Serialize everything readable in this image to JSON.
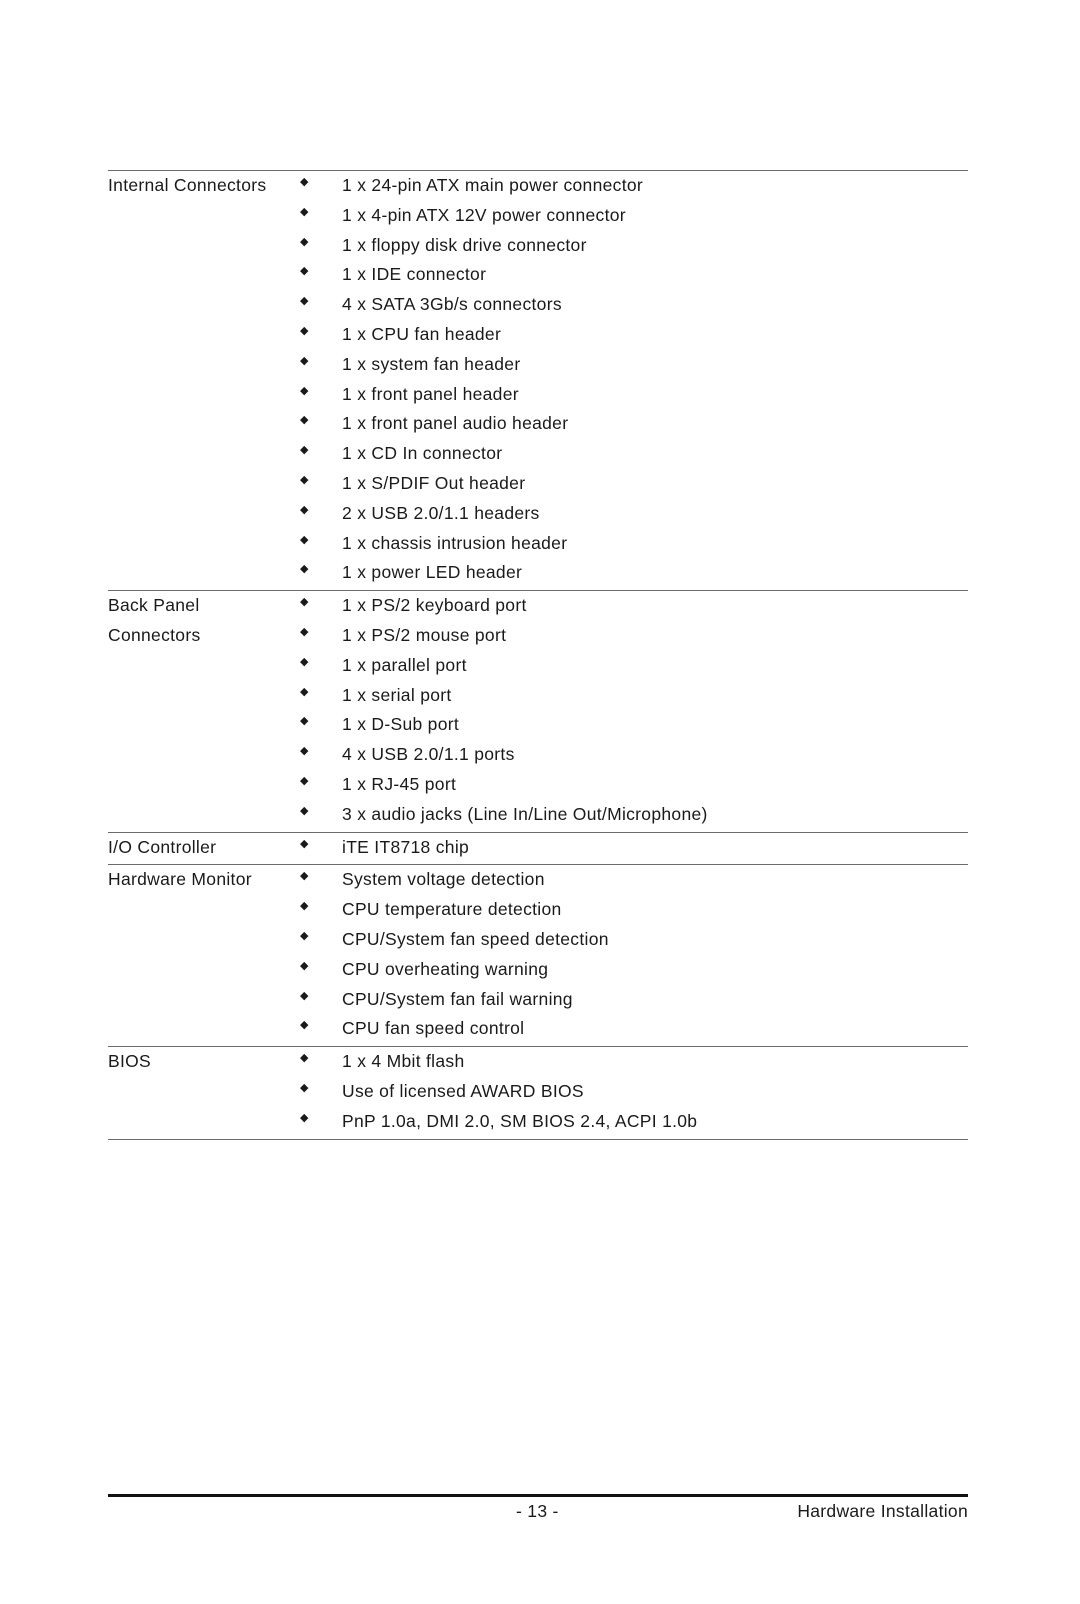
{
  "spec_table": {
    "sections": [
      {
        "label_lines": [
          "Internal Connectors"
        ],
        "items": [
          "1 x 24-pin ATX main power connector",
          "1 x 4-pin ATX 12V power connector",
          "1 x floppy disk drive connector",
          "1 x IDE connector",
          "4 x SATA 3Gb/s connectors",
          "1 x CPU fan header",
          "1 x system fan header",
          "1 x front panel header",
          "1 x front panel audio header",
          "1 x CD In connector",
          "1 x S/PDIF Out header",
          "2 x USB 2.0/1.1 headers",
          "1 x chassis intrusion header",
          "1 x power LED header"
        ]
      },
      {
        "label_lines": [
          "Back Panel",
          "Connectors"
        ],
        "items": [
          "1 x PS/2 keyboard port",
          "1 x PS/2 mouse port",
          "1 x parallel port",
          "1 x serial port",
          "1 x D-Sub port",
          "4 x USB 2.0/1.1 ports",
          "1 x RJ-45 port",
          "3 x audio jacks (Line In/Line Out/Microphone)"
        ]
      },
      {
        "label_lines": [
          "I/O Controller"
        ],
        "items": [
          "iTE IT8718 chip"
        ]
      },
      {
        "label_lines": [
          "Hardware Monitor"
        ],
        "items": [
          "System voltage detection",
          "CPU temperature detection",
          "CPU/System fan speed detection",
          "CPU overheating warning",
          "CPU/System fan fail warning",
          "CPU fan speed control"
        ]
      },
      {
        "label_lines": [
          "BIOS"
        ],
        "items": [
          "1 x 4 Mbit flash",
          "Use of licensed AWARD BIOS",
          "PnP 1.0a, DMI 2.0, SM BIOS 2.4, ACPI 1.0b"
        ]
      }
    ],
    "bullet_glyph": "◆",
    "bullet_icon": "diamond-bullet-icon"
  },
  "footer": {
    "page_number": "- 13 -",
    "chapter_title": "Hardware Installation"
  }
}
